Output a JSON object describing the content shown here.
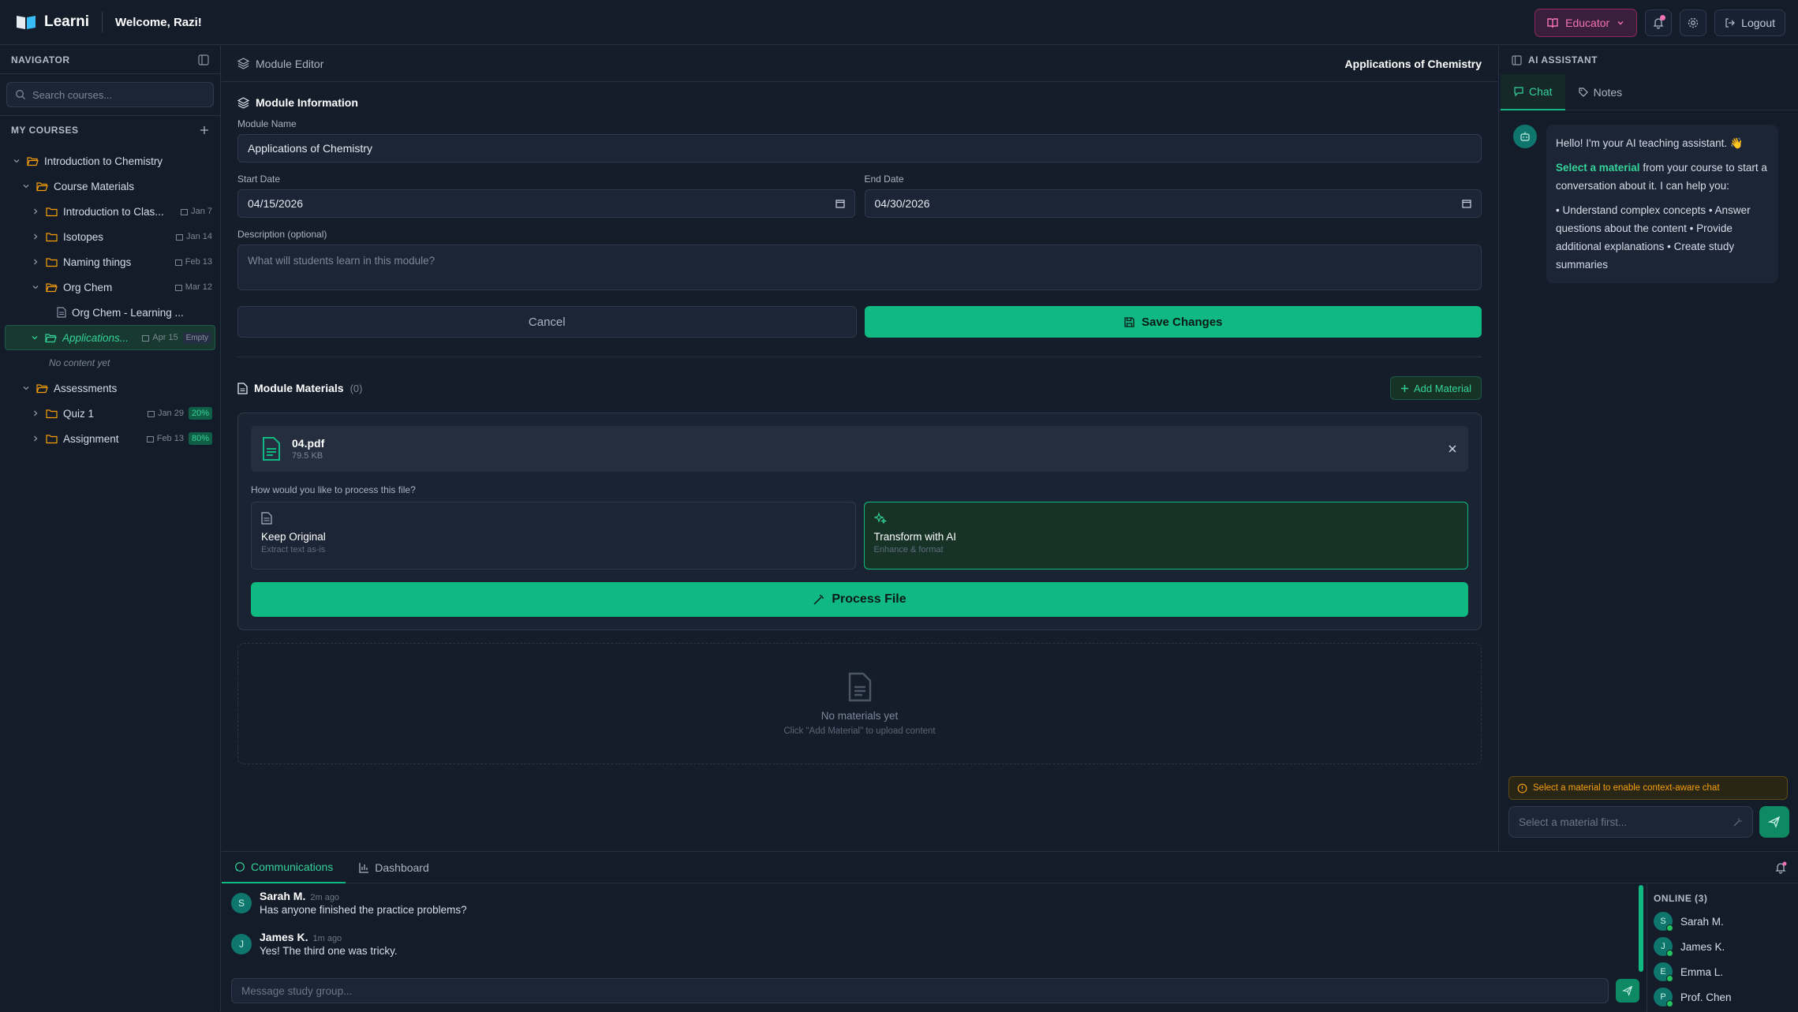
{
  "app": {
    "name": "Learni",
    "welcome": "Welcome, Razi!"
  },
  "topbar": {
    "role": "Educator",
    "logout": "Logout"
  },
  "navigator": {
    "title": "NAVIGATOR",
    "search_placeholder": "Search courses...",
    "my_courses": "MY COURSES",
    "tree": {
      "course": "Introduction to Chemistry",
      "materials_folder": "Course Materials",
      "items": [
        {
          "label": "Introduction to Clas...",
          "date": "Jan 7"
        },
        {
          "label": "Isotopes",
          "date": "Jan 14"
        },
        {
          "label": "Naming things",
          "date": "Feb 13"
        },
        {
          "label": "Org Chem",
          "date": "Mar 12"
        }
      ],
      "orgchem_child": "Org Chem - Learning ...",
      "active": {
        "label": "Applications...",
        "date": "Apr 15",
        "badge": "Empty"
      },
      "no_content": "No content yet",
      "assessments_folder": "Assessments",
      "assessments": [
        {
          "label": "Quiz 1",
          "date": "Jan 29",
          "pct": "20%"
        },
        {
          "label": "Assignment",
          "date": "Feb 13",
          "pct": "80%"
        }
      ]
    }
  },
  "editor": {
    "breadcrumb": "Module Editor",
    "module_title": "Applications of Chemistry",
    "info_title": "Module Information",
    "name_label": "Module Name",
    "name_value": "Applications of Chemistry",
    "start_label": "Start Date",
    "start_value": "04/15/2026",
    "end_label": "End Date",
    "end_value": "04/30/2026",
    "desc_label": "Description (optional)",
    "desc_placeholder": "What will students learn in this module?",
    "cancel": "Cancel",
    "save": "Save Changes",
    "materials_title": "Module Materials",
    "materials_count": "(0)",
    "add_material": "Add Material",
    "file": {
      "name": "04.pdf",
      "size": "79.5 KB"
    },
    "process_question": "How would you like to process this file?",
    "keep": {
      "title": "Keep Original",
      "sub": "Extract text as-is"
    },
    "transform": {
      "title": "Transform with AI",
      "sub": "Enhance & format"
    },
    "process_btn": "Process File",
    "empty_title": "No materials yet",
    "empty_sub": "Click \"Add Material\" to upload content"
  },
  "assistant": {
    "title": "AI ASSISTANT",
    "tabs": [
      "Chat",
      "Notes"
    ],
    "greeting": "Hello! I'm your AI teaching assistant. 👋",
    "highlight": "Select a material",
    "body": " from your course to start a conversation about it. I can help you:",
    "bullets": "• Understand complex concepts • Answer questions about the content • Provide additional explanations • Create study summaries",
    "warning": "Select a material to enable context-aware chat",
    "input_placeholder": "Select a material first..."
  },
  "bottom": {
    "tabs": [
      "Communications",
      "Dashboard"
    ],
    "messages": [
      {
        "initial": "S",
        "name": "Sarah M.",
        "time": "2m ago",
        "text": "Has anyone finished the practice problems?"
      },
      {
        "initial": "J",
        "name": "James K.",
        "time": "1m ago",
        "text": "Yes! The third one was tricky."
      }
    ],
    "input_placeholder": "Message study group...",
    "online_title": "ONLINE (3)",
    "online": [
      {
        "initial": "S",
        "name": "Sarah M."
      },
      {
        "initial": "J",
        "name": "James K."
      },
      {
        "initial": "E",
        "name": "Emma L."
      },
      {
        "initial": "P",
        "name": "Prof. Chen"
      }
    ]
  }
}
